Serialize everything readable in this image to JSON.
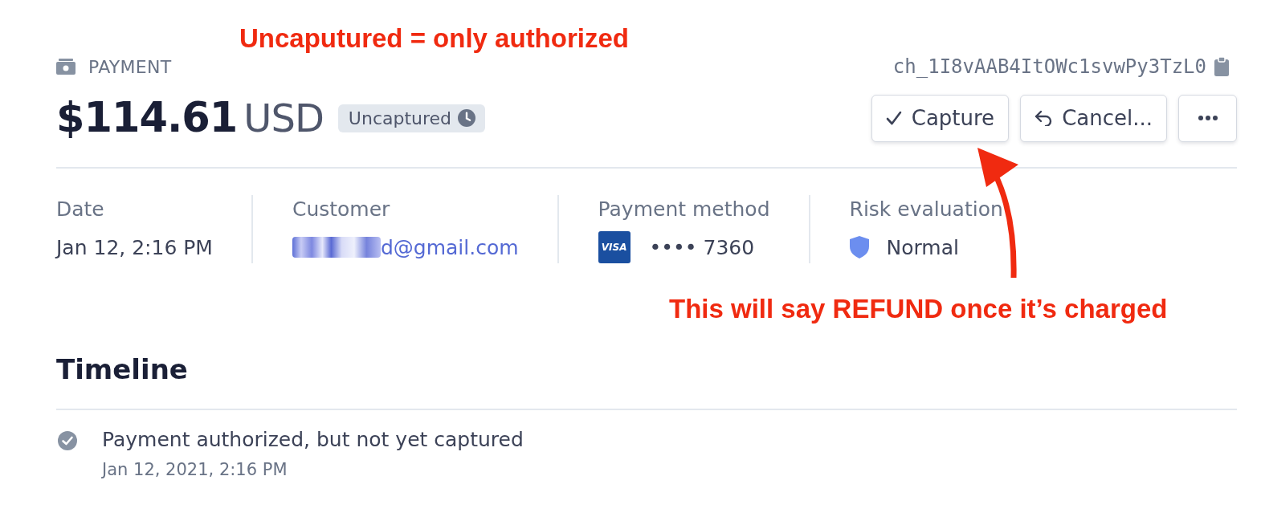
{
  "annotations": [
    {
      "text": "Uncaputured = only authorized",
      "kind": "top"
    },
    {
      "text": "This will say REFUND once it’s charged",
      "kind": "bottom"
    }
  ],
  "header": {
    "label": "PAYMENT",
    "charge_id": "ch_1I8vAAB4ItOWc1svwPy3TzL0"
  },
  "amount": {
    "value": "$114.61",
    "currency": "USD",
    "status": "Uncaptured"
  },
  "actions": [
    {
      "kind": "capture",
      "label": "Capture"
    },
    {
      "kind": "cancel",
      "label": "Cancel..."
    },
    {
      "kind": "more"
    }
  ],
  "details": [
    {
      "kind": "text",
      "label": "Date",
      "value": "Jan 12, 2:16 PM"
    },
    {
      "kind": "email",
      "label": "Customer",
      "value": "d@gmail.com"
    },
    {
      "kind": "card",
      "label": "Payment method",
      "brand": "VISA",
      "value": "•••• 7360"
    },
    {
      "kind": "risk",
      "label": "Risk evaluation",
      "value": "Normal"
    }
  ],
  "timeline": {
    "title": "Timeline",
    "events": [
      {
        "text": "Payment authorized, but not yet captured",
        "time": "Jan 12, 2021, 2:16 PM"
      }
    ]
  }
}
